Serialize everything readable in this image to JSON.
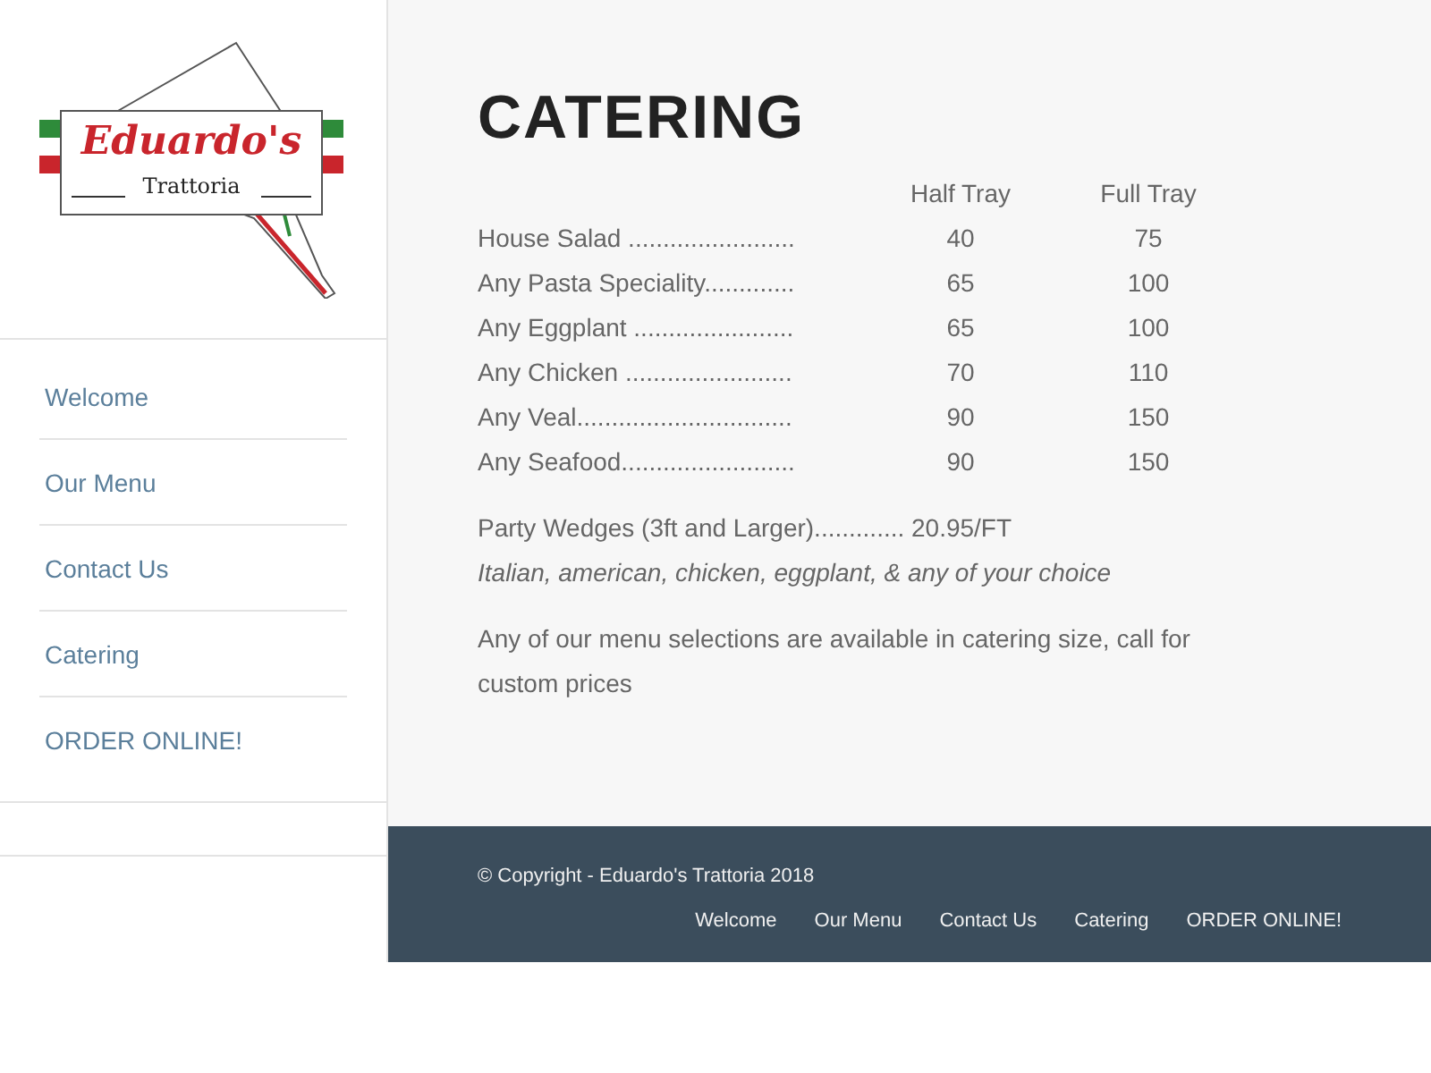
{
  "logo": {
    "name": "Eduardo's",
    "tagline": "Trattoria"
  },
  "sidebar": {
    "items": [
      {
        "label": "Welcome"
      },
      {
        "label": "Our Menu"
      },
      {
        "label": "Contact Us"
      },
      {
        "label": "Catering"
      },
      {
        "label": "ORDER ONLINE!"
      }
    ]
  },
  "page": {
    "title": "CATERING",
    "table": {
      "columns": [
        "Half Tray",
        "Full Tray"
      ],
      "rows": [
        {
          "item": "House Salad ........................",
          "half": "40",
          "full": "75"
        },
        {
          "item": "Any Pasta Speciality.............",
          "half": "65",
          "full": "100"
        },
        {
          "item": "Any Eggplant .......................",
          "half": "65",
          "full": "100"
        },
        {
          "item": "Any Chicken ........................",
          "half": "70",
          "full": "110"
        },
        {
          "item": "Any Veal...............................",
          "half": "90",
          "full": "150"
        },
        {
          "item": "Any Seafood.........................",
          "half": "90",
          "full": "150"
        }
      ]
    },
    "wedges": "Party Wedges (3ft and Larger)............. 20.95/FT",
    "wedges_note": "Italian, american, chicken, eggplant, & any of your choice",
    "note": "Any of our menu selections are available in catering size, call for custom prices"
  },
  "footer": {
    "copyright": "© Copyright - Eduardo's Trattoria 2018",
    "links": [
      "Welcome",
      "Our Menu",
      "Contact Us",
      "Catering",
      "ORDER ONLINE!"
    ]
  }
}
